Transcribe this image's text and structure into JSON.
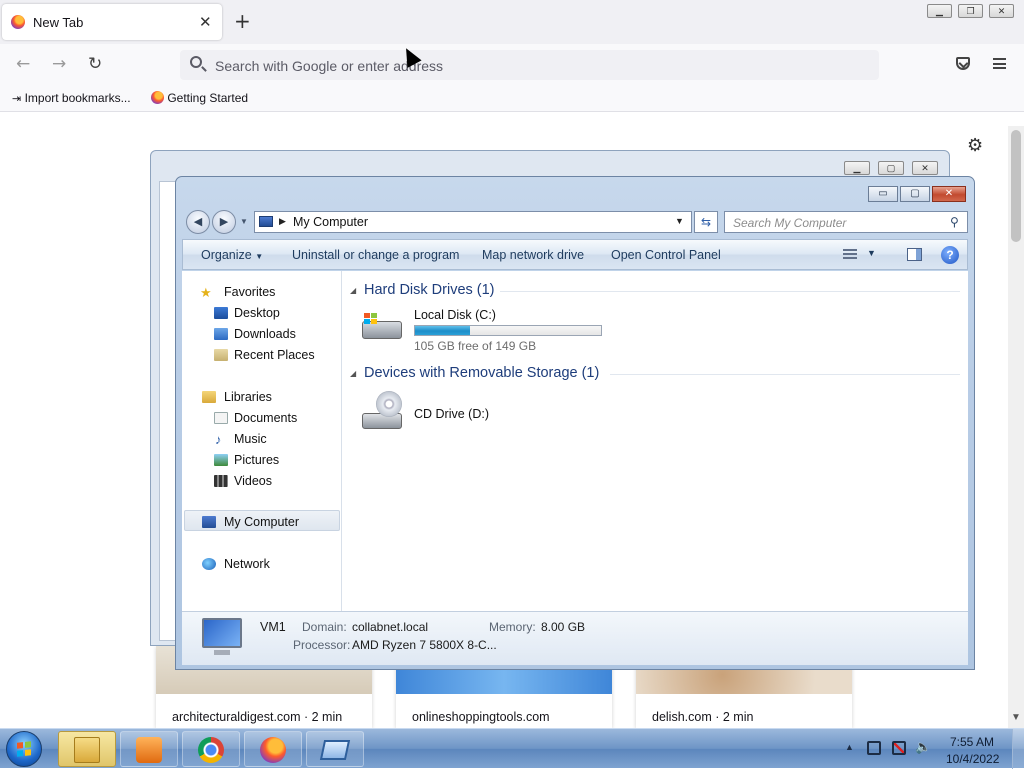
{
  "browser": {
    "tab_title": "New Tab",
    "tab_close": "✕",
    "new_tab": "+",
    "url_placeholder": "Search with Google or enter address",
    "bookmarks": [
      "Import bookmarks...",
      "Getting Started"
    ],
    "nav_back": "←",
    "nav_forward": "→",
    "nav_reload": "↻"
  },
  "newtab_page": {
    "settings_icon": "⚙",
    "tiles": [
      {
        "caption": "architecturaldigest.com · 2 min"
      },
      {
        "caption": "onlineshoppingtools.com"
      },
      {
        "caption": "delish.com · 2 min"
      }
    ]
  },
  "explorer": {
    "title_buttons": [
      "▭",
      "▢",
      "✕"
    ],
    "address": "My Computer",
    "search_placeholder": "Search My Computer",
    "commands": [
      "Organize",
      "Uninstall or change a program",
      "Map network drive",
      "Open Control Panel"
    ],
    "nav": {
      "favorites": "Favorites",
      "favorites_items": [
        "Desktop",
        "Downloads",
        "Recent Places"
      ],
      "libraries": "Libraries",
      "libraries_items": [
        "Documents",
        "Music",
        "Pictures",
        "Videos"
      ],
      "my_computer": "My Computer",
      "network": "Network"
    },
    "groups": {
      "hdd_title": "Hard Disk Drives (1)",
      "removable_title": "Devices with Removable Storage (1)"
    },
    "drives": {
      "c_name": "Local Disk (C:)",
      "c_free": "105 GB free of 149 GB",
      "c_used_fraction": 0.295,
      "d_name": "CD Drive (D:)"
    },
    "details": {
      "computer_name": "VM1",
      "domain_label": "Domain:",
      "domain_value": "collabnet.local",
      "memory_label": "Memory:",
      "memory_value": "8.00 GB",
      "processor_label": "Processor:",
      "processor_value": "AMD Ryzen 7 5800X 8-C..."
    }
  },
  "taskbar": {
    "clock_time": "7:55 AM",
    "clock_date": "10/4/2022"
  }
}
